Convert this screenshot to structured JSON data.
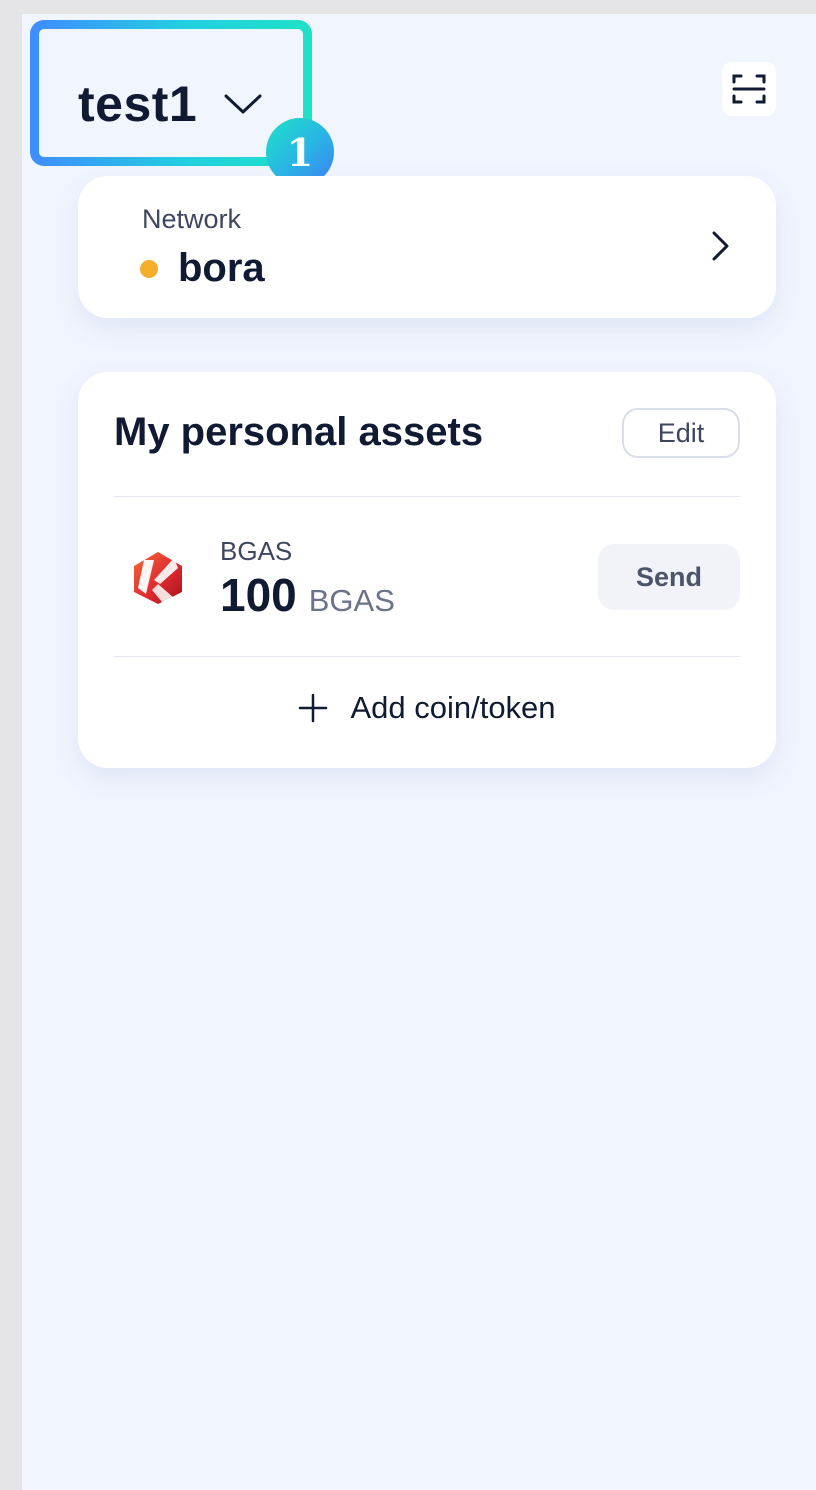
{
  "header": {
    "account_name": "test1",
    "step_badge": "1",
    "icons": {
      "account_dropdown": "chevron-down-icon",
      "scan": "scan-qr-icon"
    }
  },
  "network": {
    "label": "Network",
    "name": "bora",
    "status_color": "#f6ae2d"
  },
  "assets": {
    "title": "My personal assets",
    "edit_label": "Edit",
    "tokens": [
      {
        "symbol": "BGAS",
        "amount": "100",
        "unit": "BGAS",
        "send_label": "Send",
        "logo_icon": "bgas-token-logo"
      }
    ],
    "add_label": "Add coin/token"
  },
  "colors": {
    "background": "#f1f5fd",
    "card": "#ffffff",
    "text_primary": "#111a33",
    "highlight_gradient_start": "#3f8cff",
    "highlight_gradient_end": "#1ee2c6"
  }
}
